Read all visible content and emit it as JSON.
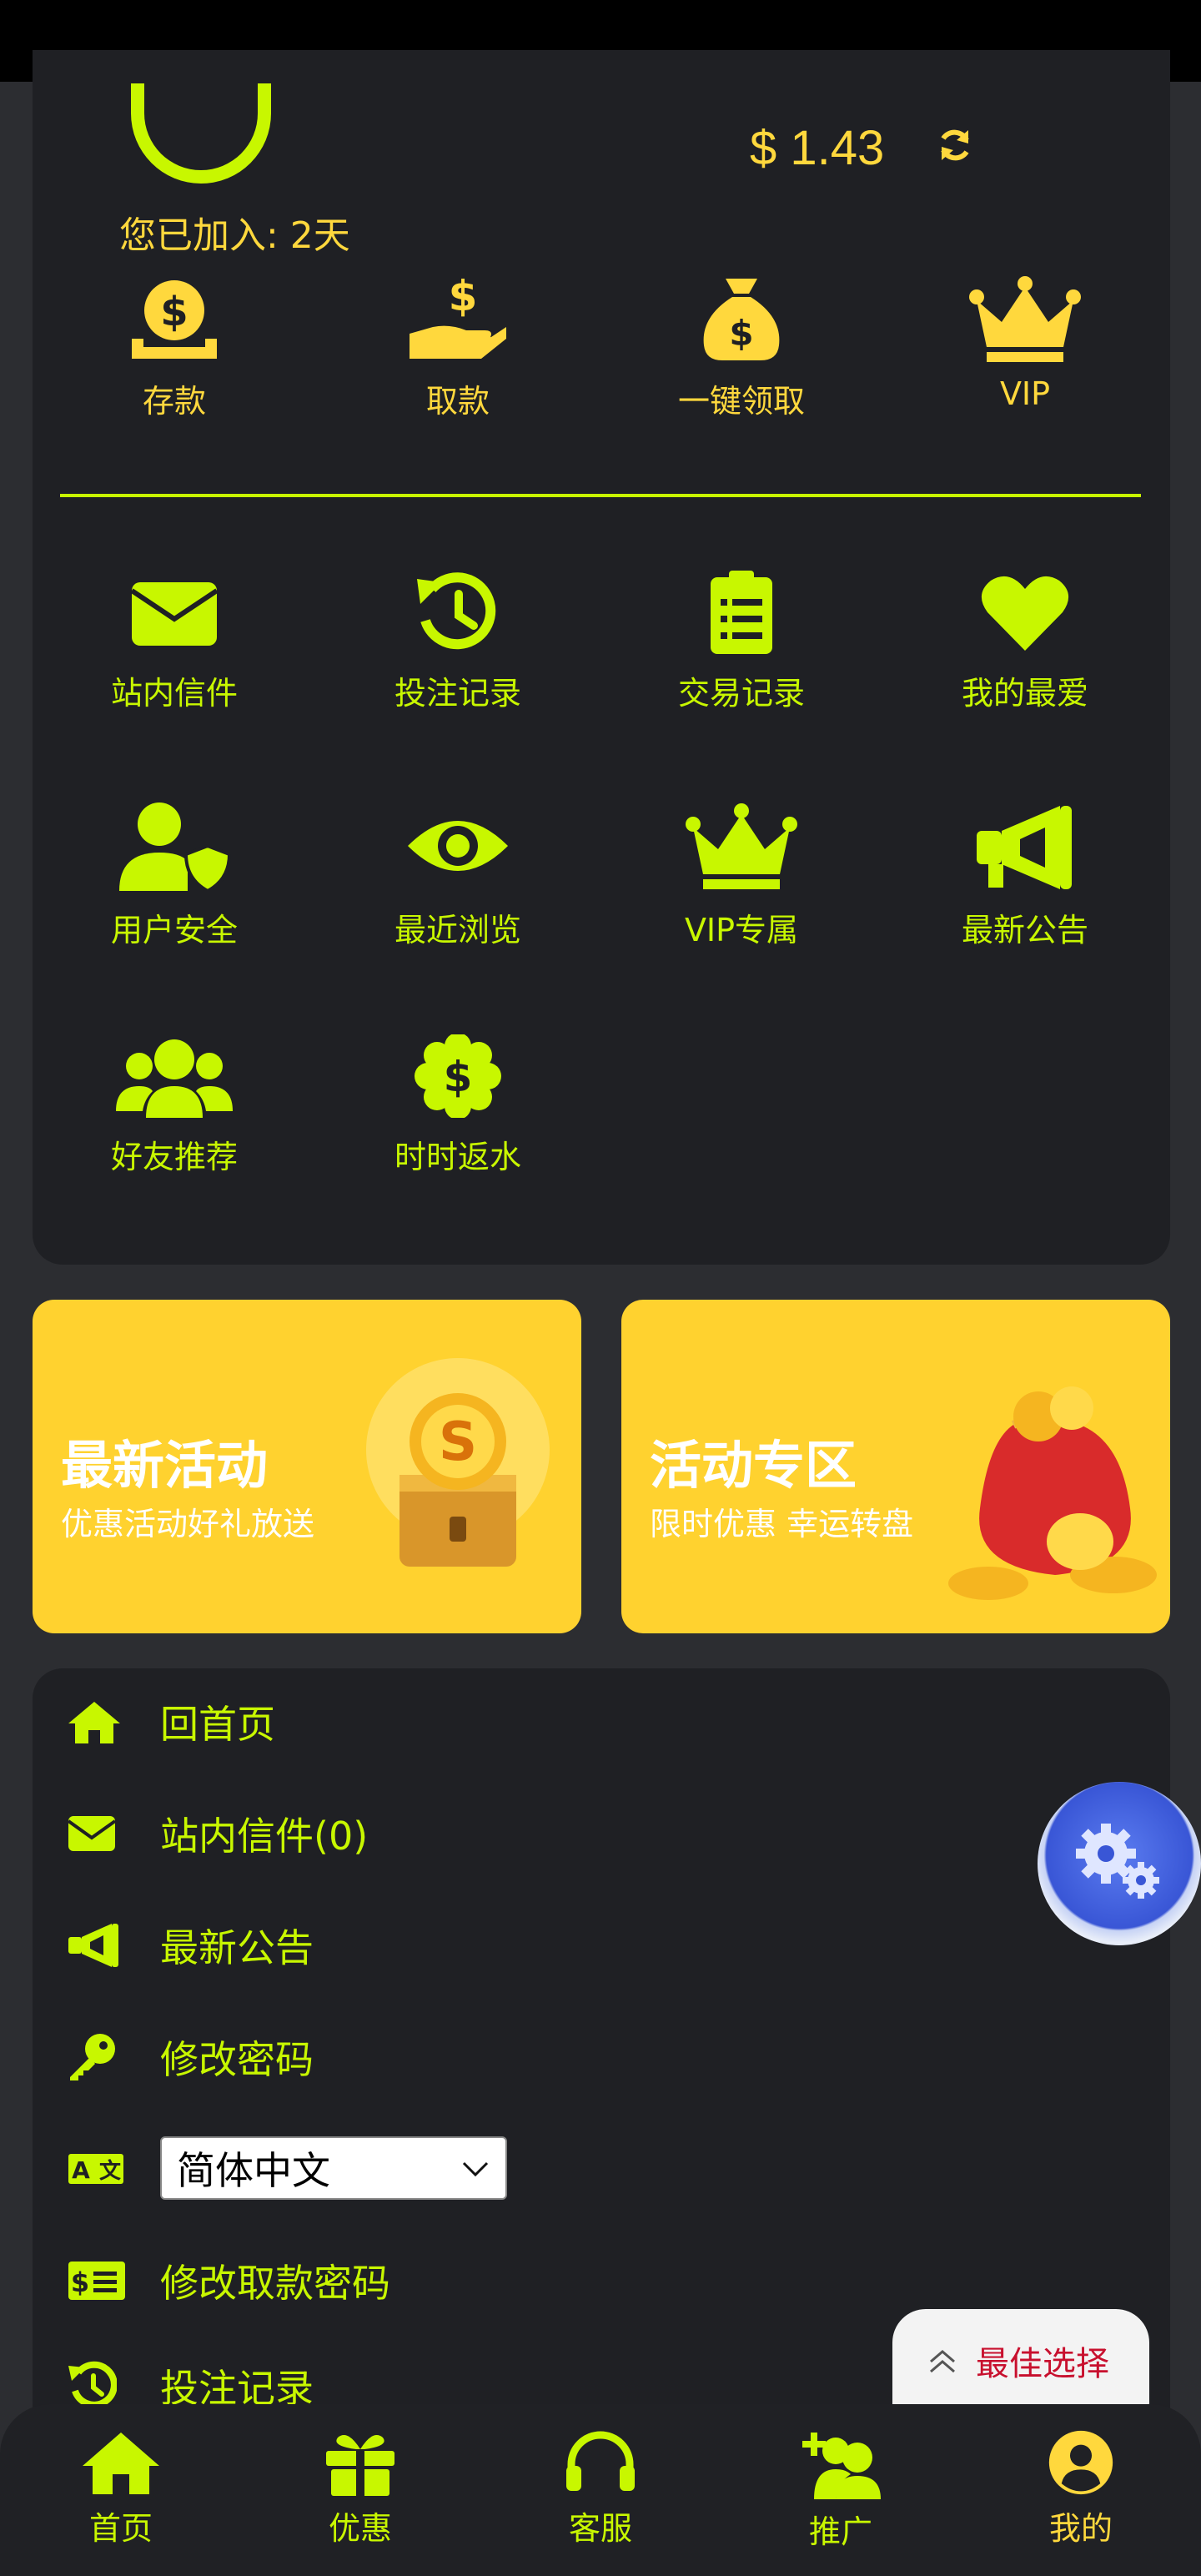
{
  "account": {
    "joined_text": "您已加入: 2天",
    "balance": "$ 1.43"
  },
  "quick_actions": [
    {
      "label": "存款",
      "icon": "deposit-coin-icon"
    },
    {
      "label": "取款",
      "icon": "withdraw-hand-icon"
    },
    {
      "label": "一键领取",
      "icon": "money-bag-icon"
    },
    {
      "label": "VIP",
      "icon": "crown-icon"
    }
  ],
  "features": [
    {
      "label": "站内信件",
      "icon": "envelope-icon"
    },
    {
      "label": "投注记录",
      "icon": "history-icon"
    },
    {
      "label": "交易记录",
      "icon": "clipboard-list-icon"
    },
    {
      "label": "我的最爱",
      "icon": "heart-icon"
    },
    {
      "label": "用户安全",
      "icon": "user-shield-icon"
    },
    {
      "label": "最近浏览",
      "icon": "eye-icon"
    },
    {
      "label": "VIP专属",
      "icon": "crown-icon"
    },
    {
      "label": "最新公告",
      "icon": "megaphone-icon"
    },
    {
      "label": "好友推荐",
      "icon": "users-icon"
    },
    {
      "label": "时时返水",
      "icon": "dollar-badge-icon"
    }
  ],
  "banners": [
    {
      "title": "最新活动",
      "subtitle": "优惠活动好礼放送"
    },
    {
      "title": "活动专区",
      "subtitle": "限时优惠 幸运转盘"
    }
  ],
  "menu": [
    {
      "label": "回首页",
      "icon": "home-icon"
    },
    {
      "label": "站内信件(0)",
      "icon": "envelope-icon"
    },
    {
      "label": "最新公告",
      "icon": "megaphone-icon"
    },
    {
      "label": "修改密码",
      "icon": "key-icon"
    },
    {
      "label": "修改取款密码",
      "icon": "money-card-icon"
    },
    {
      "label": "投注记录",
      "icon": "history-icon"
    }
  ],
  "language": {
    "selected": "简体中文",
    "icon": "translate-icon"
  },
  "floating": {
    "best_choice": "最佳选择"
  },
  "bottom_nav": [
    {
      "label": "首页",
      "icon": "home-icon"
    },
    {
      "label": "优惠",
      "icon": "gift-icon"
    },
    {
      "label": "客服",
      "icon": "headset-icon"
    },
    {
      "label": "推广",
      "icon": "user-plus-icon"
    },
    {
      "label": "我的",
      "icon": "user-circle-icon"
    }
  ],
  "colors": {
    "accent": "#c8f700",
    "gold": "#ffd83d",
    "banner": "#ffd22f",
    "card": "#1f2024",
    "background": "#2c2d31"
  }
}
